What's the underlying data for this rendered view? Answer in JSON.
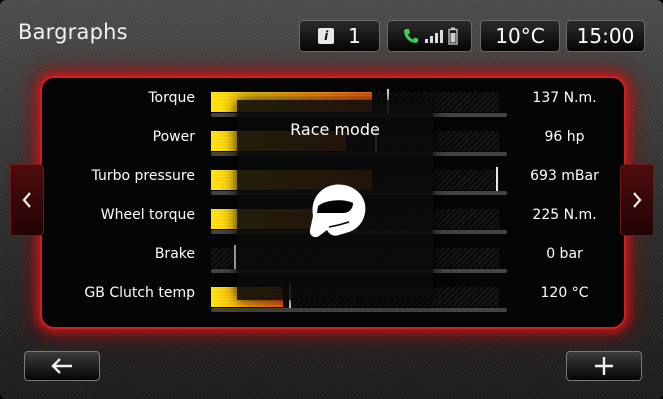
{
  "header": {
    "title": "Bargraphs",
    "info_count": "1",
    "temperature": "10°C",
    "clock": "15:00"
  },
  "overlay": {
    "title": "Race mode",
    "icon": "helmet-icon"
  },
  "gauges": [
    {
      "label": "Torque",
      "value": "137 N.m.",
      "fill_fraction": 0.56,
      "marker_fraction": 0.61
    },
    {
      "label": "Power",
      "value": "96 hp",
      "fill_fraction": 0.47,
      "marker_fraction": 0.57
    },
    {
      "label": "Turbo pressure",
      "value": "693 mBar",
      "fill_fraction": 0.56,
      "marker_fraction": 0.99
    },
    {
      "label": "Wheel torque",
      "value": "225 N.m.",
      "fill_fraction": 0.49,
      "marker_fraction": null
    },
    {
      "label": "Brake",
      "value": "0 bar",
      "fill_fraction": 0.0,
      "marker_fraction": 0.08
    },
    {
      "label": "GB Clutch temp",
      "value": "120 °C",
      "fill_fraction": 0.25,
      "marker_fraction": 0.27
    }
  ],
  "icons": {
    "info": "info-icon",
    "phone": "phone-icon",
    "signal": "signal-bars-icon",
    "battery": "battery-icon",
    "left_arrow": "chevron-left-icon",
    "right_arrow": "chevron-right-icon",
    "back": "back-arrow-icon",
    "add": "plus-icon"
  },
  "colors": {
    "accent_red": "#cc2020",
    "bar_start": "#ffe000",
    "bar_end": "#ff5a00",
    "phone_green": "#39d24a"
  }
}
